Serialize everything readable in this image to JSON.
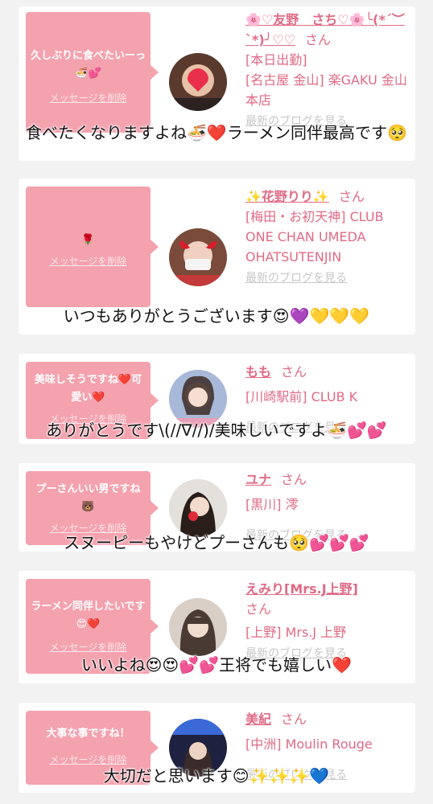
{
  "delete_label": "メッセージを削除",
  "san": "さん",
  "blog_label": "最新のブログを見る",
  "entries": [
    {
      "message": "久しぶりに食べたいーっ🍜💕",
      "name": "🌸♡友野　さち♡🌸╰(*´︶`*)╯♡♡",
      "status": "[本日出勤]",
      "shop": "[名古屋 金山] 楽GAKU 金山本店",
      "overlay": "食べたくなりますよね🍜❤️ラーメン同伴最高です🥺"
    },
    {
      "message": "🌹",
      "name": "✨花野りり✨",
      "status": "",
      "shop": "[梅田・お初天神] CLUB ONE CHAN UMEDA OHATSUTENJIN",
      "overlay": "いつもありがとうございます😍💜💛💛💛"
    },
    {
      "message": "美味しそうですね❤️可愛い❤️",
      "name": "もも",
      "status": "",
      "shop": "[川崎駅前] CLUB K",
      "overlay": "ありがとうです\\(//∇//)/美味しいですよ🍜💕💕"
    },
    {
      "message": "プーさんいい男ですね🐻",
      "name": "ユナ",
      "status": "",
      "shop": "[黒川] 澪",
      "overlay": "スヌーピーもやけどプーさんも🥺💕💕💕"
    },
    {
      "message": "ラーメン同伴したいです😍❤️",
      "name": "えみり[Mrs.J上野]",
      "status": "",
      "shop": "[上野] Mrs.J 上野",
      "overlay": "いいよね😍😍💕💕王将でも嬉しい❤️"
    },
    {
      "message": "大事な事ですね！",
      "name": "美紀",
      "status": "",
      "shop": "[中洲] Moulin Rouge",
      "overlay": "大切だと思います😊✨✨✨💙"
    }
  ]
}
